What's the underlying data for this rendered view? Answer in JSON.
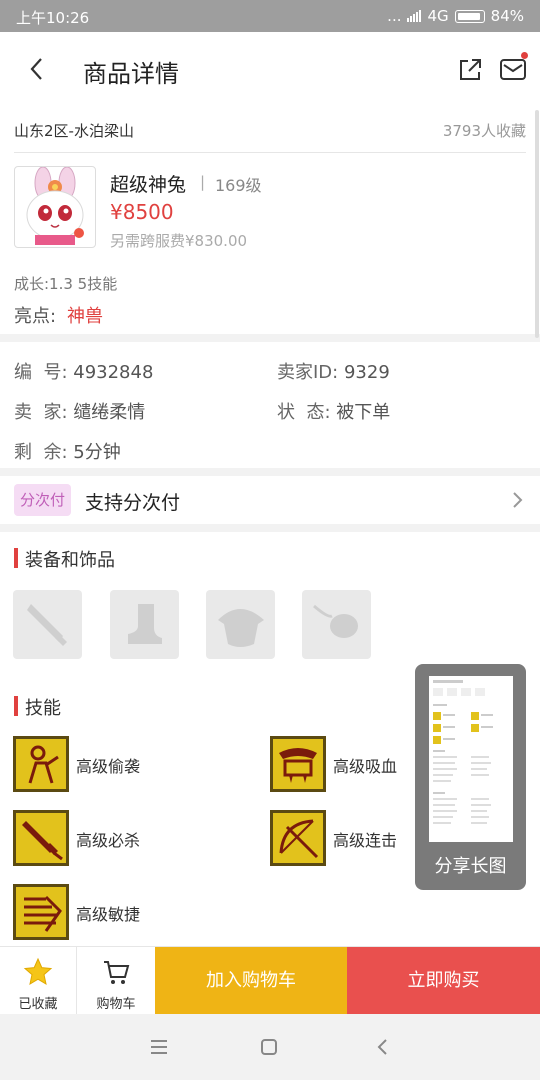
{
  "status_bar": {
    "time": "上午10:26",
    "dots": "...",
    "network": "4G",
    "battery": "84%"
  },
  "nav": {
    "title": "商品详情",
    "back_icon": "chevron-left-icon",
    "share_icon": "share-icon",
    "message_icon": "mail-icon"
  },
  "product": {
    "server": "山东2区-水泊梁山",
    "favorites": "3793人收藏",
    "name": "超级神兔",
    "separator": "|",
    "level": "169级",
    "price": "¥8500",
    "cross_server_fee": "另需跨服费¥830.00",
    "growth": "成长:1.3 5技能",
    "highlight_label": "亮点:",
    "highlight_value": "神兽"
  },
  "details": {
    "id_label": "编  号:",
    "id_value": "4932848",
    "seller_id_label": "卖家ID:",
    "seller_id_value": "9329",
    "seller_label": "卖  家:",
    "seller_value": "缱绻柔情",
    "status_label": "状  态:",
    "status_value": "被下单",
    "remaining_label": "剩  余:",
    "remaining_value": "5分钟"
  },
  "installment": {
    "tag": "分次付",
    "text": "支持分次付"
  },
  "equipment": {
    "title": "装备和饰品",
    "slots": [
      "sword-icon",
      "boot-icon",
      "armor-icon",
      "accessory-icon"
    ]
  },
  "skills": {
    "title": "技能",
    "items": [
      {
        "name": "高级偷袭",
        "icon": "sneak-attack-icon"
      },
      {
        "name": "高级吸血",
        "icon": "vampire-icon"
      },
      {
        "name": "高级必杀",
        "icon": "critical-sword-icon"
      },
      {
        "name": "高级连击",
        "icon": "combo-bow-icon"
      },
      {
        "name": "高级敏捷",
        "icon": "agility-icon"
      }
    ]
  },
  "share": {
    "label": "分享长图"
  },
  "bottom_bar": {
    "favorited_label": "已收藏",
    "cart_label": "购物车",
    "add_to_cart": "加入购物车",
    "buy_now": "立即购买"
  },
  "colors": {
    "accent_red": "#e0413f",
    "add_to_cart": "#efb415",
    "buy_now": "#e9504e",
    "installment_tag_bg": "#f5dcf4",
    "skill_icon_bg": "#e2c21c"
  }
}
